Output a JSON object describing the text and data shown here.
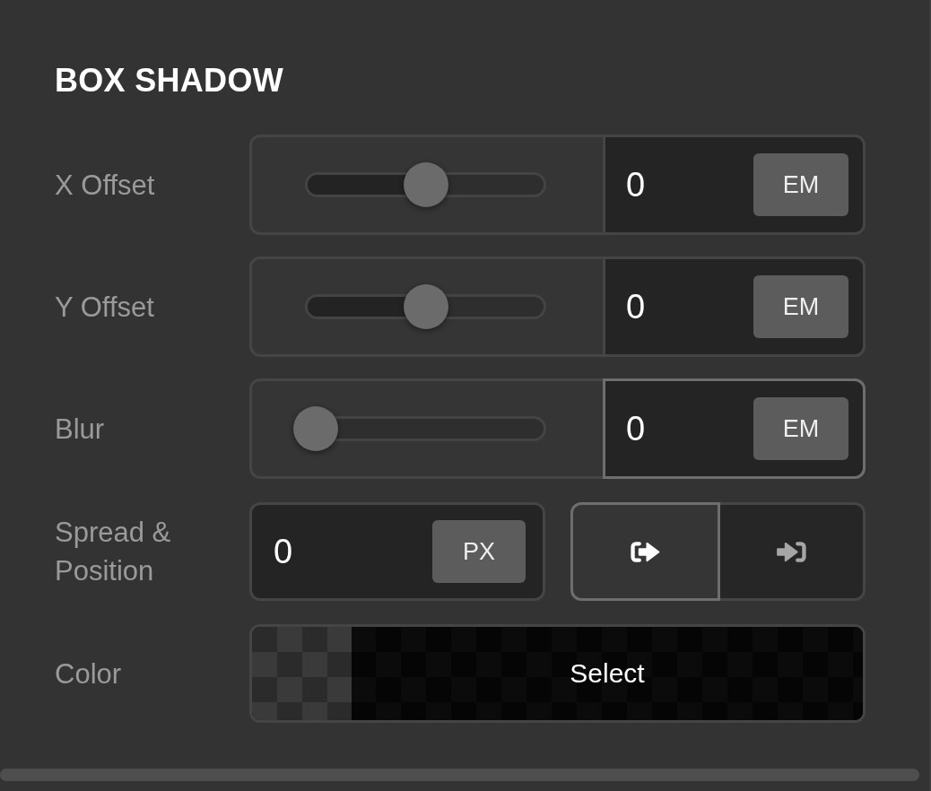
{
  "panel": {
    "title": "BOX SHADOW"
  },
  "rows": [
    {
      "kind": "slider",
      "label": "X Offset",
      "level": 0.5,
      "value": "0",
      "unit": "EM",
      "focused": false
    },
    {
      "kind": "slider",
      "label": "Y Offset",
      "level": 0.5,
      "value": "0",
      "unit": "EM",
      "focused": false
    },
    {
      "kind": "slider",
      "label": "Blur",
      "level": 0,
      "value": "0",
      "unit": "EM",
      "focused": true
    },
    {
      "kind": "spread",
      "label": "Spread & Position",
      "value": "0",
      "unit": "PX",
      "positions": [
        {
          "kind": "outset",
          "selected": true
        },
        {
          "kind": "inset",
          "selected": false
        }
      ]
    },
    {
      "kind": "color",
      "label": "Color",
      "button": "Select"
    }
  ]
}
